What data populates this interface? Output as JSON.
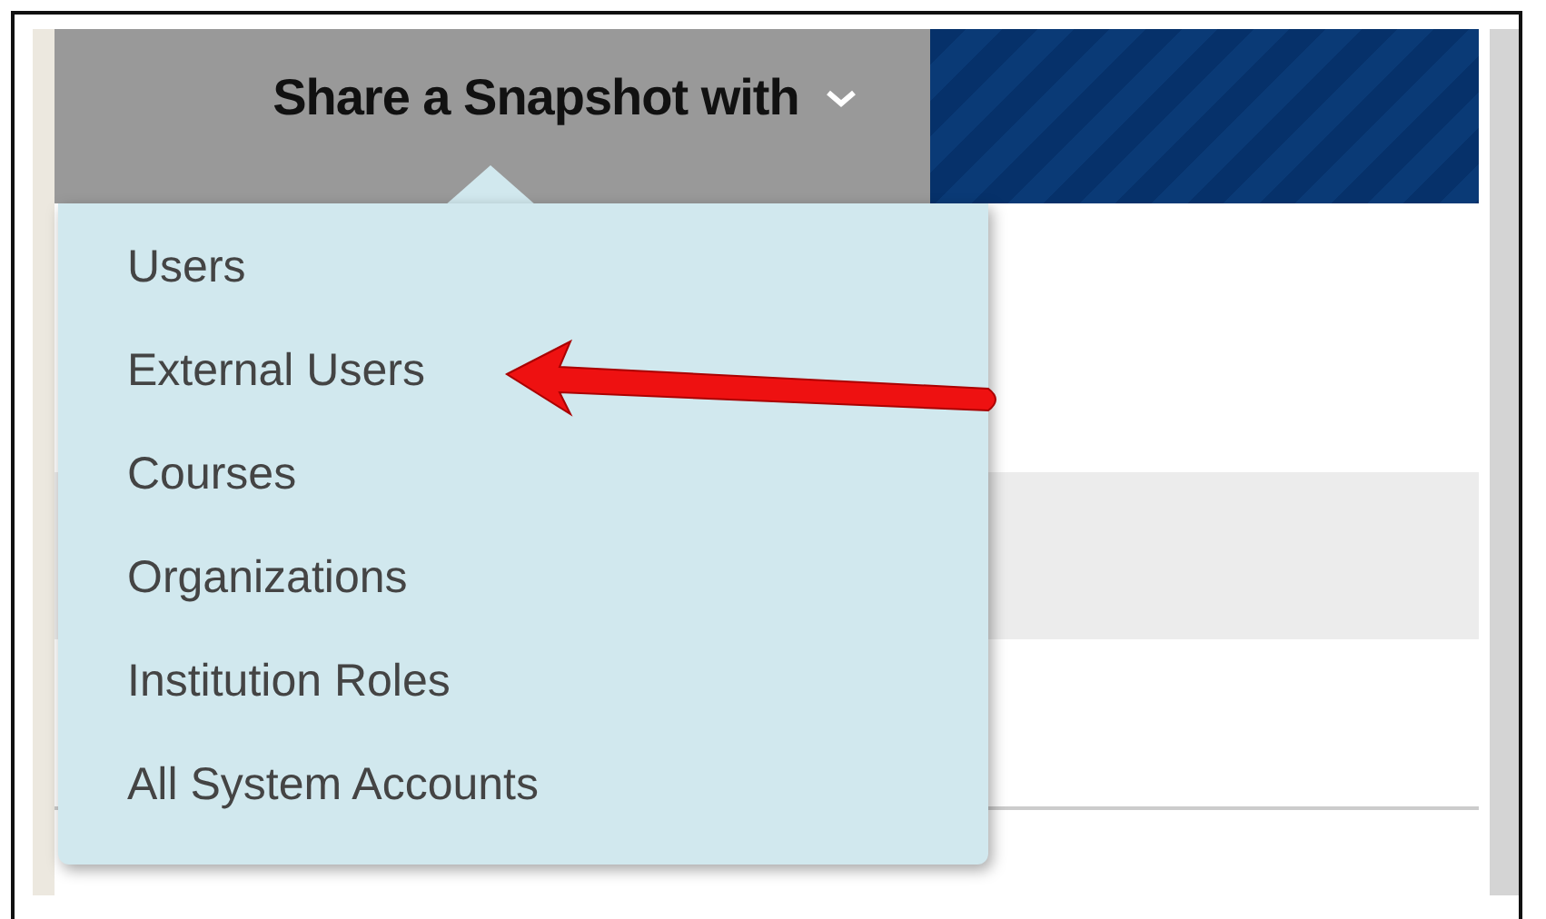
{
  "header": {
    "menu_button": {
      "label": "Share a Snapshot with",
      "expanded": true
    }
  },
  "menu": {
    "items": [
      {
        "label": "Users"
      },
      {
        "label": "External Users"
      },
      {
        "label": "Courses"
      },
      {
        "label": "Organizations"
      },
      {
        "label": "Institution Roles"
      },
      {
        "label": "All System Accounts"
      }
    ]
  }
}
